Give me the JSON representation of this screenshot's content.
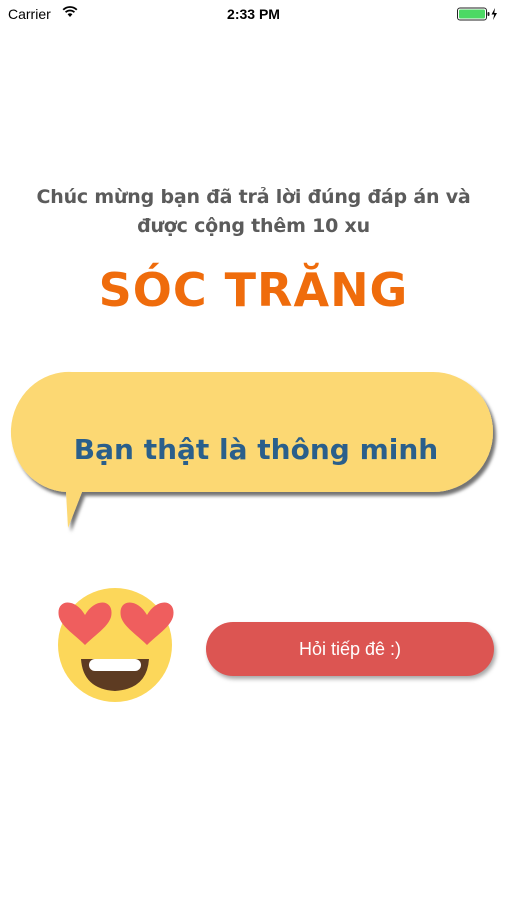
{
  "status_bar": {
    "carrier": "Carrier",
    "time": "2:33 PM",
    "wifi_icon": "wifi-icon",
    "battery_icon": "battery-charging-icon"
  },
  "result": {
    "congrats_line1": "Chúc mừng bạn đã trả lời đúng đáp án và",
    "congrats_line2": "được cộng thêm 10 xu",
    "answer": "SÓC TRĂNG"
  },
  "speech_bubble": {
    "text": "Bạn thật là thông minh"
  },
  "emoji": {
    "icon": "heart-eyes-emoji-icon"
  },
  "actions": {
    "next_label": "Hỏi tiếp đê :)"
  },
  "colors": {
    "accent_orange": "#ef6c0c",
    "bubble_yellow": "#fcd873",
    "bubble_text": "#2a5f8b",
    "button_red": "#dc5552",
    "text_gray": "#5b5b5b"
  }
}
